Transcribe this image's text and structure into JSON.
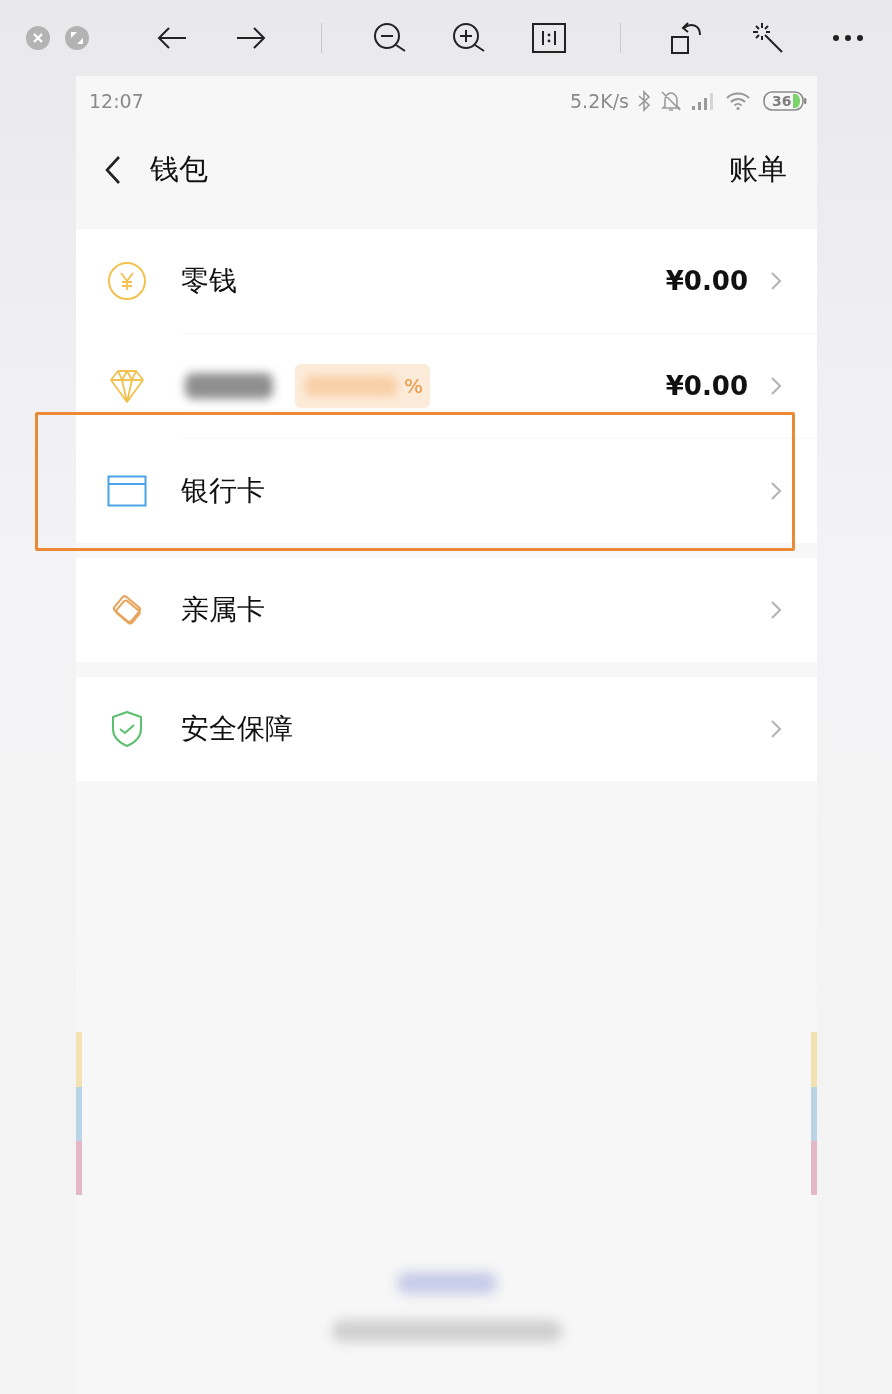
{
  "status_bar": {
    "time": "12:07",
    "network_speed": "5.2K/s",
    "battery": "36"
  },
  "header": {
    "title": "钱包",
    "action": "账单"
  },
  "groups": [
    {
      "rows": [
        {
          "kind": "plain",
          "label": "零钱",
          "value": "¥0.00",
          "highlighted": false
        },
        {
          "kind": "redacted",
          "badge_suffix": "%",
          "value": "¥0.00",
          "highlighted": false
        },
        {
          "kind": "plain",
          "label": "银行卡",
          "highlighted": true
        }
      ]
    },
    {
      "rows": [
        {
          "kind": "plain",
          "label": "亲属卡",
          "highlighted": false
        }
      ]
    },
    {
      "rows": [
        {
          "kind": "plain",
          "label": "安全保障",
          "highlighted": false
        }
      ]
    }
  ]
}
